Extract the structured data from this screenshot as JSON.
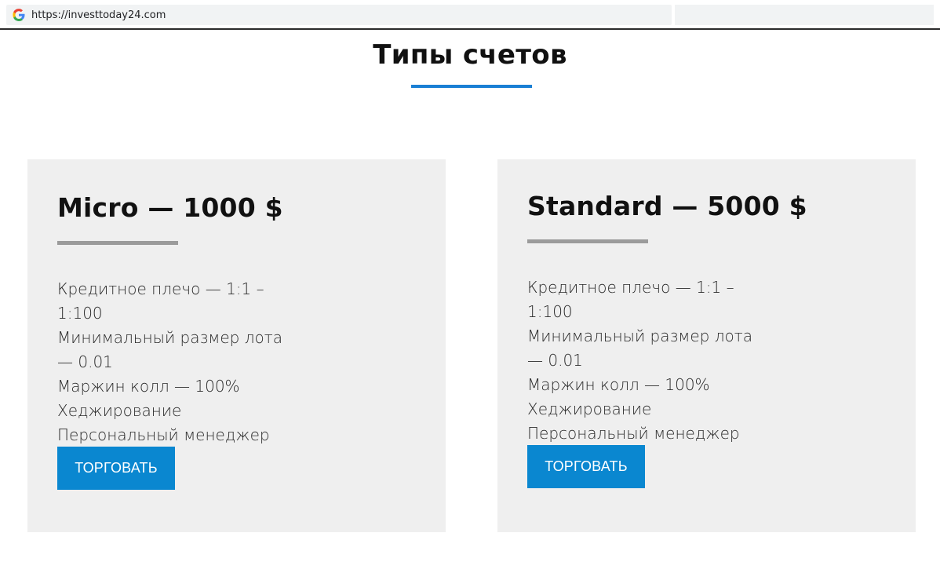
{
  "browser": {
    "url": "https://investtoday24.com",
    "favicon": "google-g-icon"
  },
  "section": {
    "title": "Типы счетов",
    "accent_color": "#1a7fd4"
  },
  "accounts": [
    {
      "title": "Micro — 1000 $",
      "features": [
        "Кредитное плечо — 1:1 –1:100",
        "Минимальный размер лота",
        "— 0.01",
        "Маржин колл — 100%",
        "Хеджирование",
        "Персональный менеджер"
      ],
      "button_label": "ТОРГОВАТЬ"
    },
    {
      "title": "Standard — 5000 $",
      "features": [
        "Кредитное плечо — 1:1 –1:100",
        "Минимальный размер лота",
        "— 0.01",
        "Маржин колл — 100%",
        "Хеджирование",
        "Персональный менеджер"
      ],
      "button_label": "ТОРГОВАТЬ"
    }
  ],
  "colors": {
    "card_background": "#efefef",
    "button_background": "#0a87d0",
    "divider": "#9b9b9b"
  }
}
